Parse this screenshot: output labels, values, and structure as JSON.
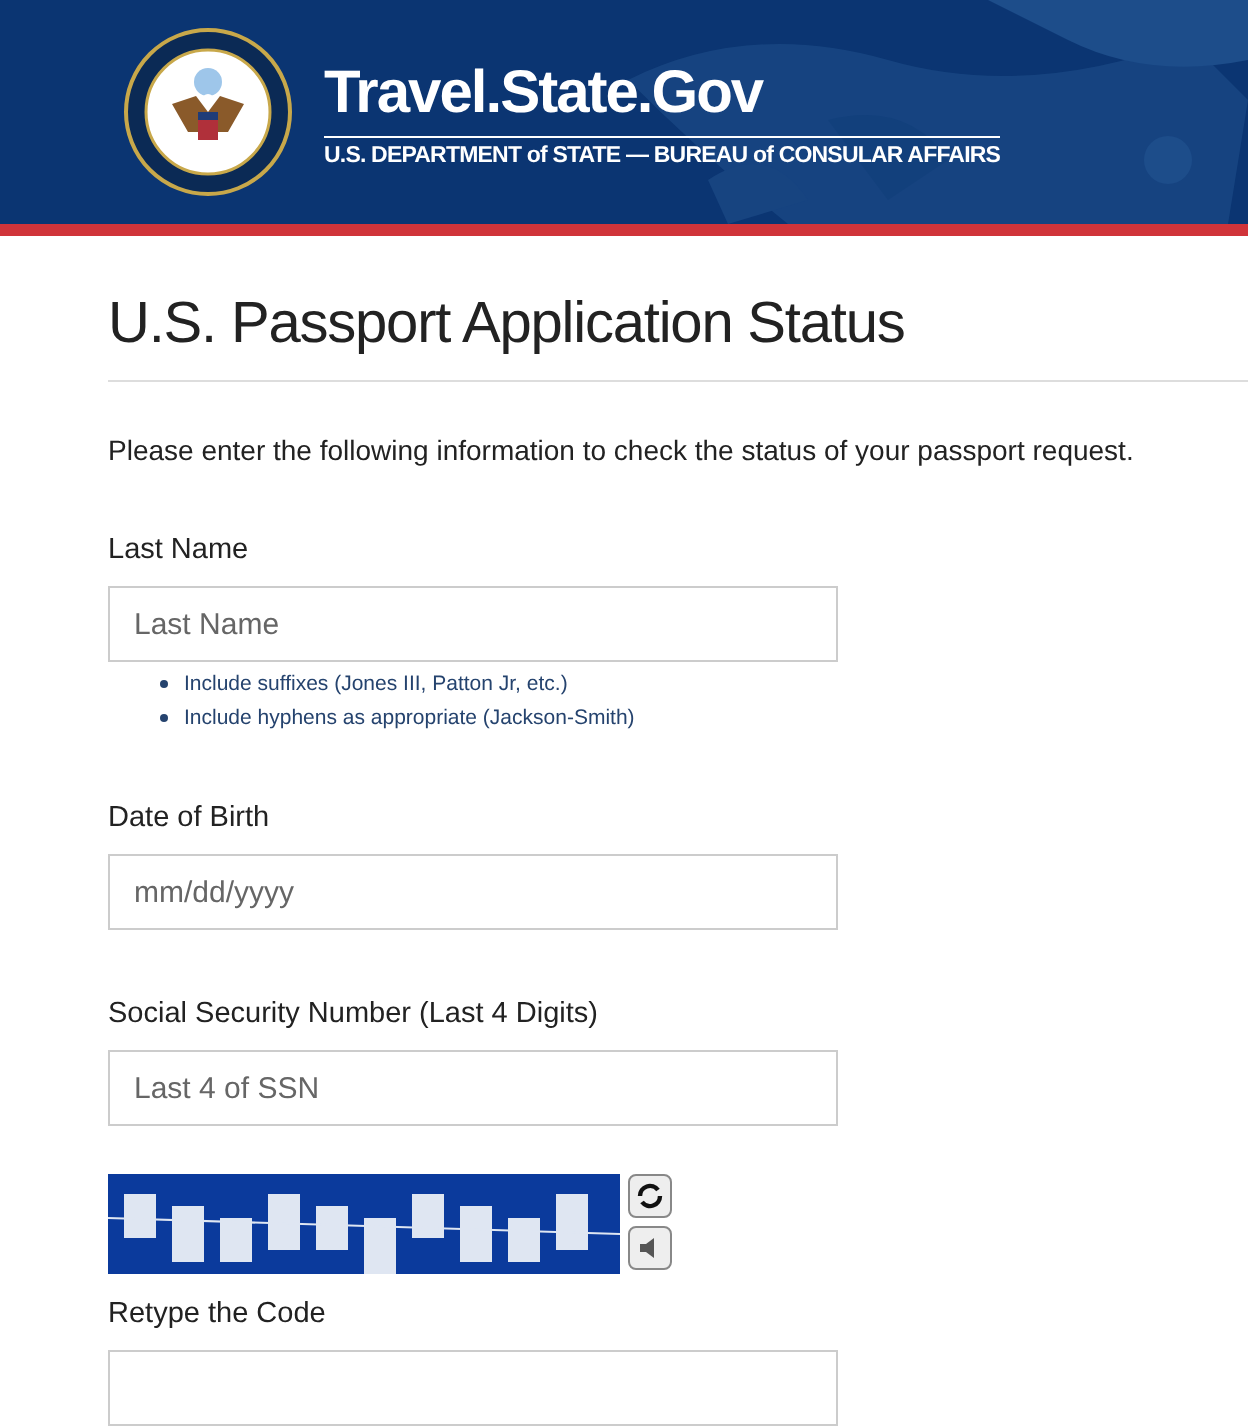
{
  "header": {
    "site_title": "Travel.State.Gov",
    "subtitle": "U.S. DEPARTMENT of STATE — BUREAU of CONSULAR AFFAIRS"
  },
  "page_title": "U.S. Passport Application Status",
  "intro": "Please enter the following information to check the status of your passport request.",
  "fields": [
    {
      "label": "Last Name",
      "placeholder": "Last Name",
      "hints": [
        "Include suffixes (Jones III, Patton Jr, etc.)",
        "Include hyphens as appropriate (Jackson-Smith)"
      ]
    },
    {
      "label": "Date of Birth",
      "placeholder": "mm/dd/yyyy"
    },
    {
      "label": "Social Security Number (Last 4 Digits)",
      "placeholder": "Last 4 of SSN"
    }
  ],
  "captcha": {
    "kind": "picture",
    "label": "Retype the Code"
  }
}
